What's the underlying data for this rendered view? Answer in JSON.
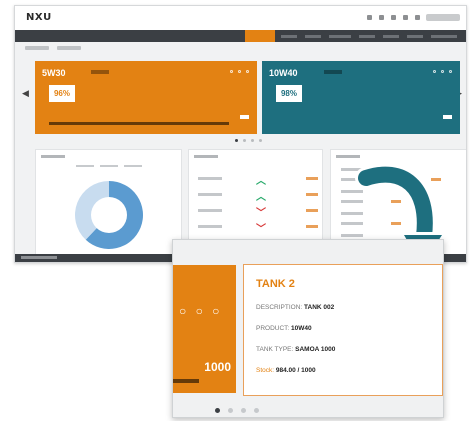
{
  "app": {
    "logo": "NXU"
  },
  "cards": [
    {
      "title": "5W30",
      "percent": "96%",
      "color": "#e38213",
      "level": 0.92
    },
    {
      "title": "10W40",
      "percent": "98%",
      "color": "#1e6f7f",
      "level": 0.0
    }
  ],
  "zoom": {
    "number": "1000",
    "tank_title": "TANK 2",
    "description_label": "DESCRIPTION:",
    "description_value": "TANK 002",
    "product_label": "PRODUCT:",
    "product_value": "10W40",
    "tank_type_label": "TANK TYPE:",
    "tank_type_value": "SAMOA 1000",
    "stock_label": "Stock:",
    "stock_value": "984.00 / 1000",
    "dots": "○ ○ ○"
  },
  "donut_chart": {
    "type": "pie",
    "values": [
      62,
      38
    ],
    "colors": [
      "#5b9bd0",
      "#c8dcef"
    ]
  },
  "colors": {
    "accent": "#e38213",
    "teal": "#1e6f7f",
    "nav": "#3b3f44",
    "up": "#27a96a",
    "down": "#d73a3a"
  },
  "icons": [
    "bell-icon",
    "user-icon",
    "chevron-left-icon",
    "chevron-right-icon",
    "arrow-up-icon",
    "arrow-down-icon",
    "curved-arrow-icon"
  ]
}
